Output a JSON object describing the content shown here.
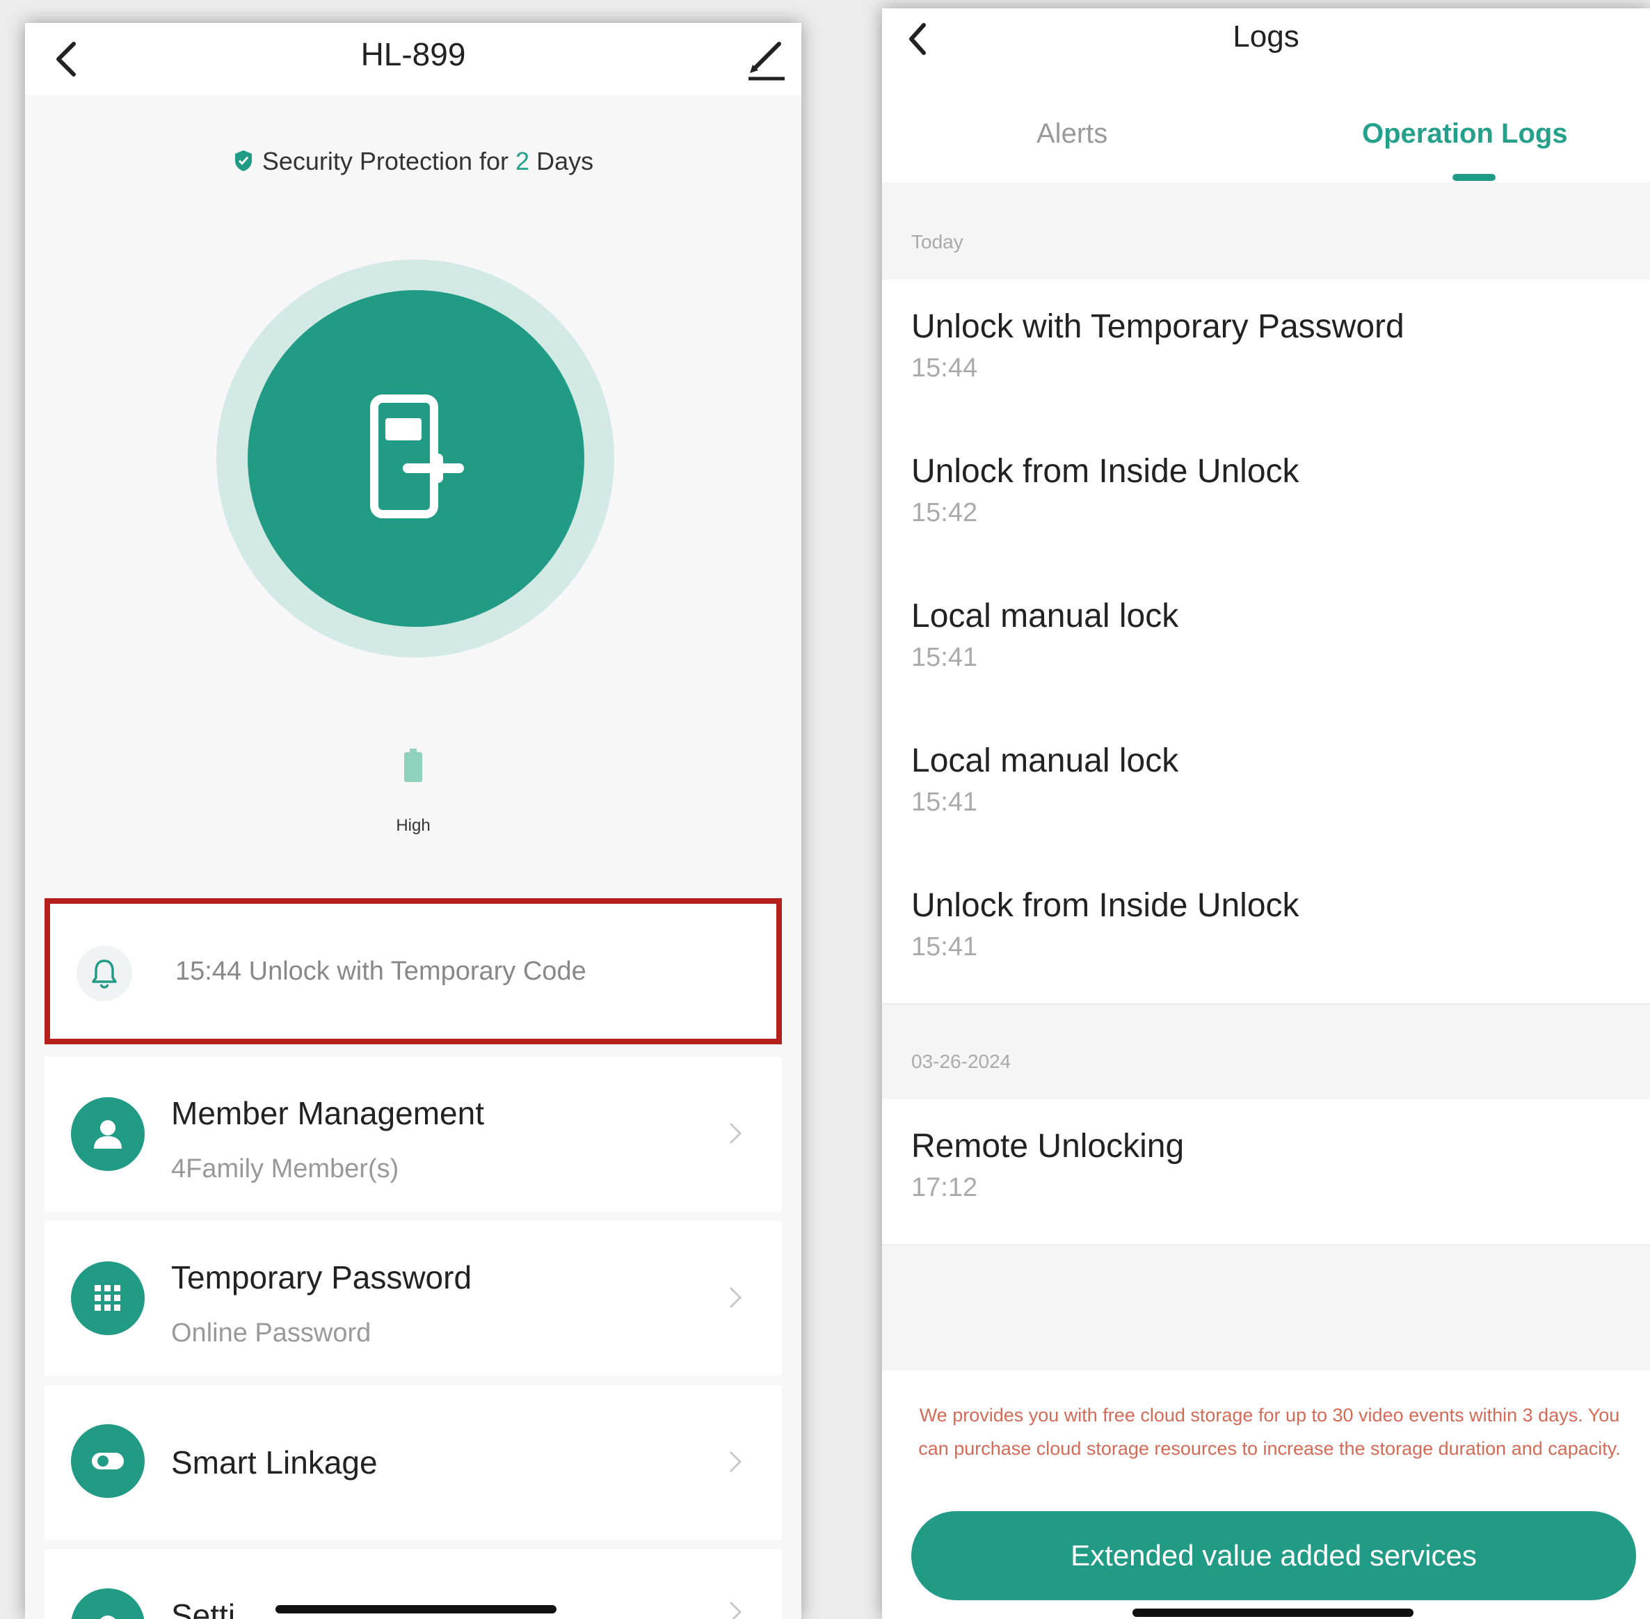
{
  "left_screen": {
    "header": {
      "title": "HL-899"
    },
    "security": {
      "prefix": "Security Protection for",
      "days": "2",
      "suffix": "Days"
    },
    "battery": {
      "label": "High"
    },
    "latest_event": {
      "text": "15:44 Unlock with Temporary Code"
    },
    "menu": [
      {
        "icon": "person-icon",
        "title": "Member Management",
        "subtitle": "4Family Member(s)"
      },
      {
        "icon": "keypad-icon",
        "title": "Temporary Password",
        "subtitle": "Online Password"
      },
      {
        "icon": "toggle-icon",
        "title": "Smart Linkage",
        "subtitle": ""
      },
      {
        "icon": "gear-icon",
        "title": "Setti",
        "subtitle": ""
      }
    ]
  },
  "right_screen": {
    "header": {
      "title": "Logs"
    },
    "tabs": [
      {
        "label": "Alerts",
        "active": false
      },
      {
        "label": "Operation Logs",
        "active": true
      }
    ],
    "sections": [
      {
        "label": "Today",
        "logs": [
          {
            "title": "Unlock with Temporary Password",
            "time": "15:44"
          },
          {
            "title": "Unlock from Inside Unlock",
            "time": "15:42"
          },
          {
            "title": "Local manual lock",
            "time": "15:41"
          },
          {
            "title": "Local manual lock",
            "time": "15:41"
          },
          {
            "title": "Unlock from Inside Unlock",
            "time": "15:41"
          }
        ]
      },
      {
        "label": "03-26-2024",
        "logs": [
          {
            "title": "Remote Unlocking",
            "time": "17:12"
          }
        ]
      }
    ],
    "notice": "We provides you with free cloud storage for up to 30 video events within 3 days. You can purchase cloud storage resources to increase the storage duration and capacity.",
    "cta_label": "Extended value added services"
  },
  "colors": {
    "accent": "#229b86",
    "accent_light": "#d3e9e4",
    "highlight_border": "#b5201d",
    "notice_text": "#d36b56"
  }
}
